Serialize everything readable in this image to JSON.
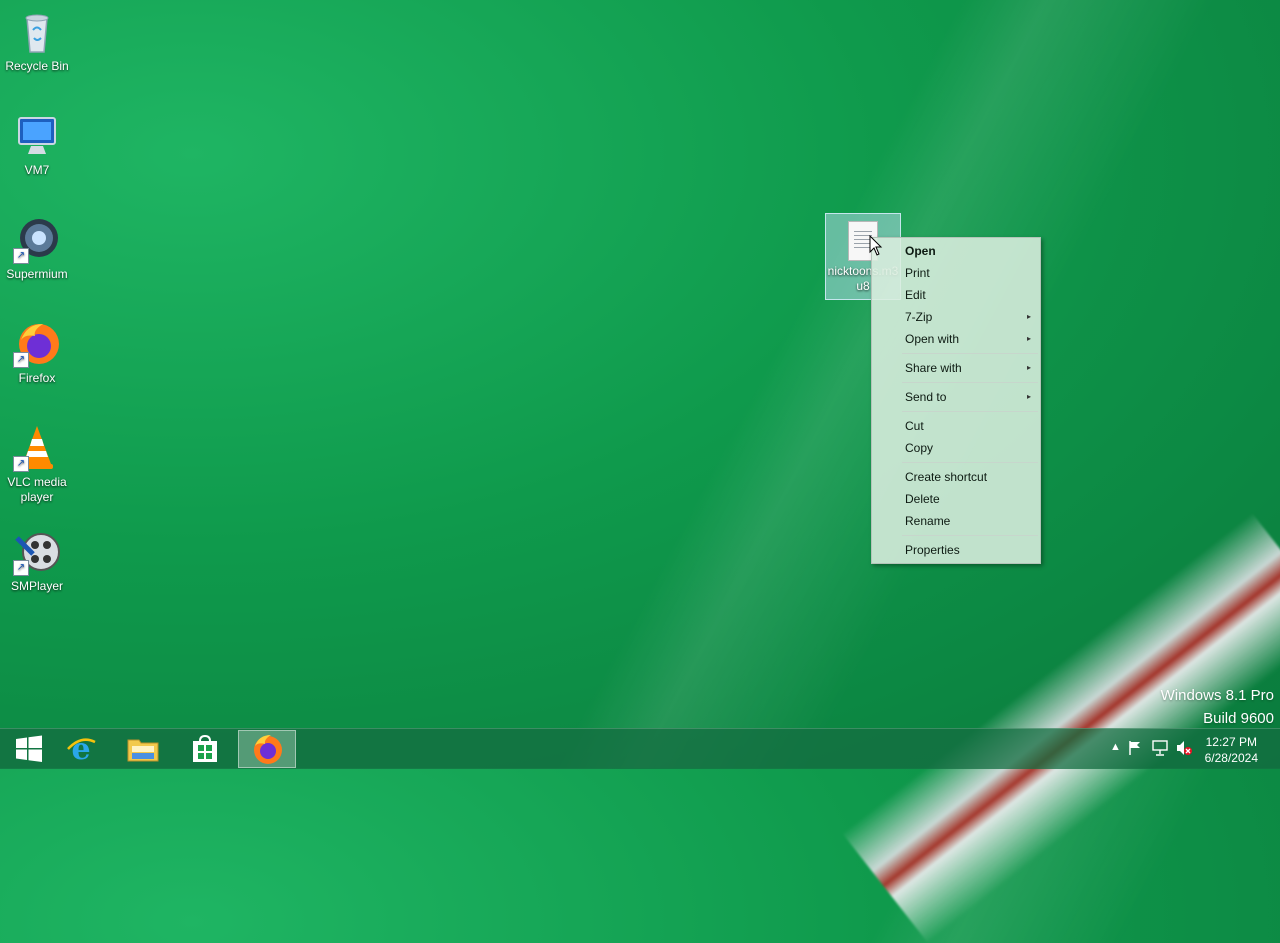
{
  "desktop": {
    "icons": [
      {
        "label": "Recycle Bin",
        "icon": "recycle-bin-icon"
      },
      {
        "label": "VM7",
        "icon": "computer-icon"
      },
      {
        "label": "Supermium",
        "icon": "supermium-icon"
      },
      {
        "label": "Firefox",
        "icon": "firefox-icon"
      },
      {
        "label": "VLC media player",
        "icon": "vlc-icon"
      },
      {
        "label": "SMPlayer",
        "icon": "smplayer-icon"
      }
    ],
    "selected_file": {
      "label": "nicktoons.m3u8",
      "icon": "text-file-icon"
    }
  },
  "context_menu": {
    "items": [
      {
        "label": "Open",
        "bold": true
      },
      {
        "label": "Print"
      },
      {
        "label": "Edit"
      },
      {
        "label": "7-Zip",
        "submenu": true
      },
      {
        "label": "Open with",
        "submenu": true
      },
      {
        "label": "Share with",
        "submenu": true
      },
      {
        "label": "Send to",
        "submenu": true
      },
      {
        "label": "Cut"
      },
      {
        "label": "Copy"
      },
      {
        "label": "Create shortcut"
      },
      {
        "label": "Delete"
      },
      {
        "label": "Rename"
      },
      {
        "label": "Properties"
      }
    ],
    "submenu_glyph": "▸"
  },
  "watermark": {
    "line1": "Windows 8.1 Pro",
    "line2": "Build 9600"
  },
  "taskbar": {
    "buttons": [
      {
        "name": "start",
        "icon": "windows-logo-icon"
      },
      {
        "name": "internet-explorer",
        "icon": "internet-explorer-icon"
      },
      {
        "name": "file-explorer",
        "icon": "folder-icon"
      },
      {
        "name": "store",
        "icon": "store-icon"
      },
      {
        "name": "firefox",
        "icon": "firefox-icon",
        "active": true
      }
    ],
    "tray": {
      "time": "12:27 PM",
      "date": "6/28/2024",
      "icons": [
        "show-hidden-icons-icon",
        "action-center-flag-icon",
        "network-icon",
        "volume-muted-icon"
      ]
    }
  },
  "colors": {
    "accent": "#0f9a4c",
    "menu_bg": "#dbeedf"
  }
}
